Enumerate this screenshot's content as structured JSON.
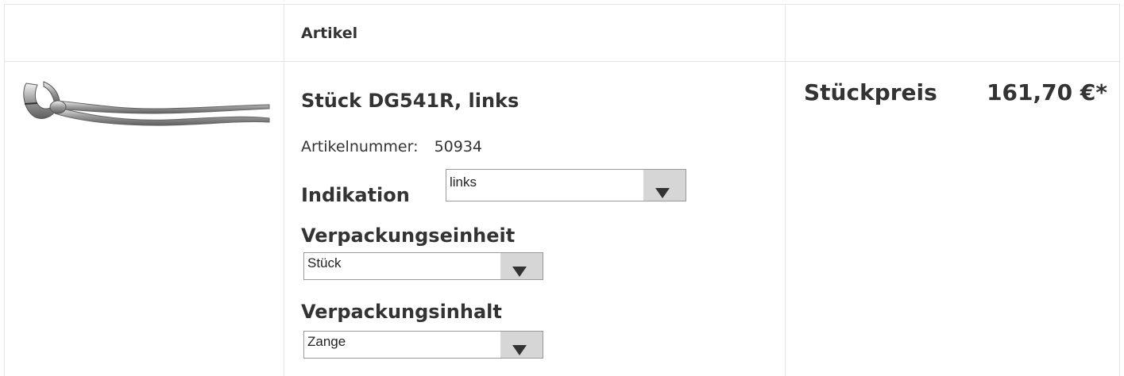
{
  "table": {
    "headers": {
      "article": "Artikel",
      "unit_price": "Stückpreis"
    }
  },
  "product": {
    "title": "Stück DG541R, links",
    "article_number_label": "Artikelnummer:",
    "article_number": "50934",
    "price": "161,70 €*",
    "image_icon": "dental-forceps-image"
  },
  "options": {
    "indikation": {
      "label": "Indikation",
      "selected": "links"
    },
    "verpackungseinheit": {
      "label": "Verpackungseinheit",
      "selected": "Stück"
    },
    "verpackungsinhalt": {
      "label": "Verpackungsinhalt",
      "selected": "Zange"
    }
  },
  "colors": {
    "border": "#e4e4e4",
    "text": "#333333",
    "select_arrow_bg": "#d6d6d6"
  }
}
